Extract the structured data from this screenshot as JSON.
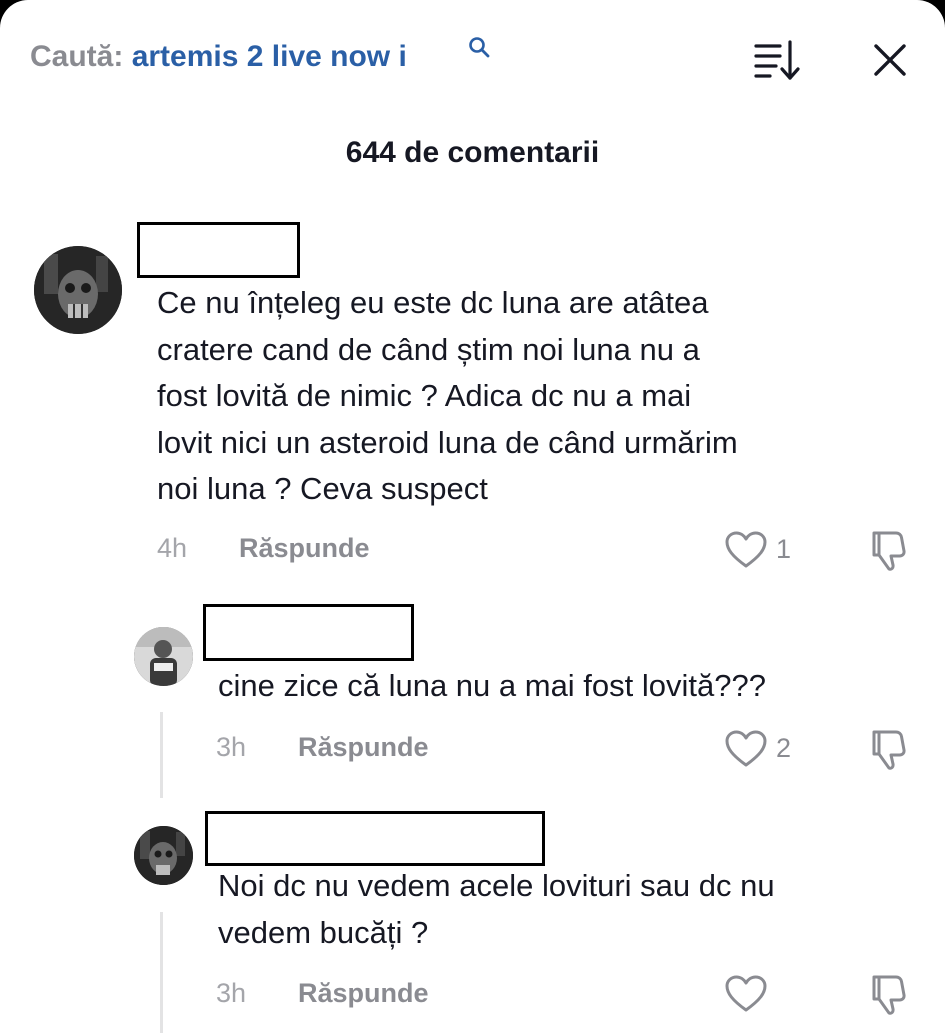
{
  "search": {
    "label": "Caută:",
    "query": "artemis 2 live now i"
  },
  "header": {
    "count_text": "644 de comentarii"
  },
  "comments": [
    {
      "text_lines": [
        "Ce nu înțeleg eu este dc luna are atâtea",
        "cratere cand de când știm noi luna nu a",
        "fost lovită de nimic ? Adica dc nu a mai",
        "lovit nici un asteroid luna de când urmărim",
        "noi luna ? Ceva suspect"
      ],
      "time": "4h",
      "reply_label": "Răspunde",
      "likes": "1"
    },
    {
      "text_lines": [
        "cine zice că luna nu a mai fost lovită???"
      ],
      "time": "3h",
      "reply_label": "Răspunde",
      "likes": "2"
    },
    {
      "text_lines": [
        "Noi dc nu vedem acele lovituri sau dc nu",
        "vedem bucăți ?"
      ],
      "time": "3h",
      "reply_label": "Răspunde",
      "likes": ""
    }
  ],
  "icons": {
    "search": "search-icon",
    "sort": "sort-icon",
    "close": "close-icon",
    "like": "heart-outline-icon",
    "dislike": "thumbs-down-icon"
  },
  "colors": {
    "query": "#2a5fa6",
    "muted": "#8a8b91",
    "text": "#161823"
  }
}
